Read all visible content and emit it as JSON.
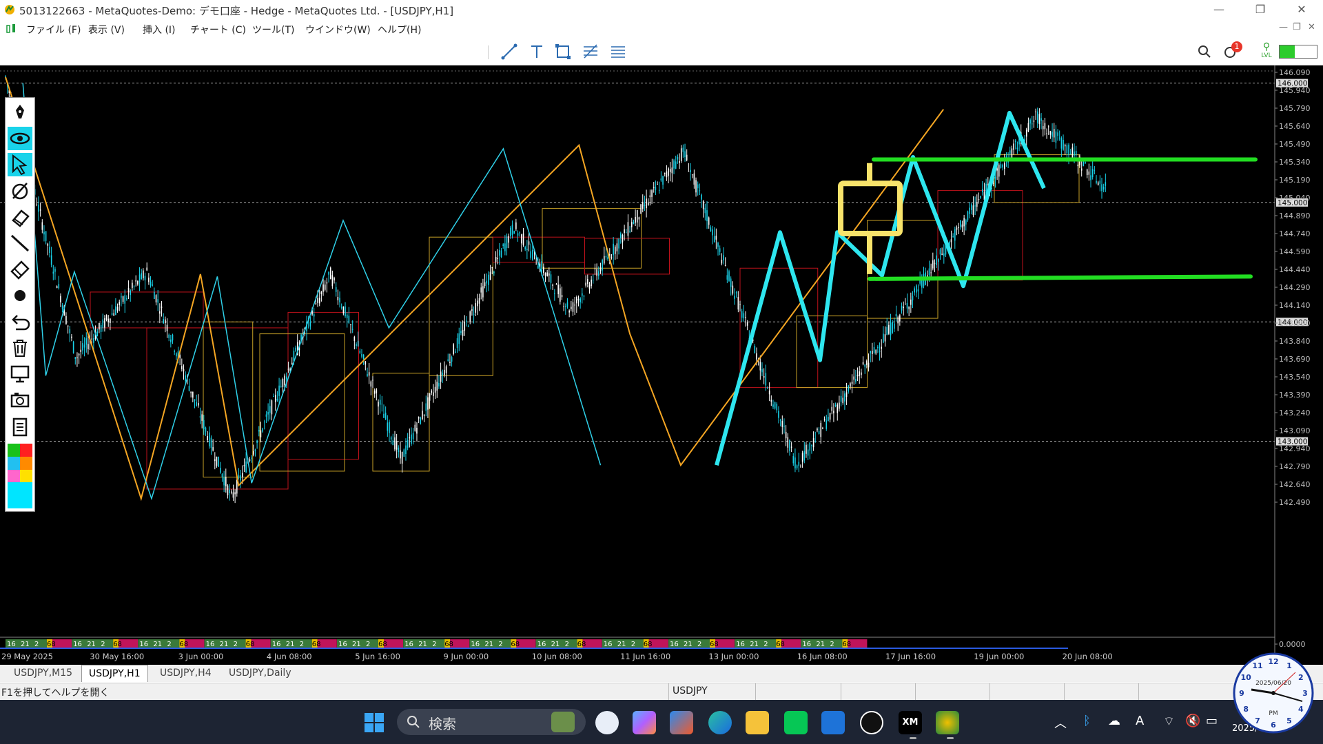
{
  "window": {
    "title": "5013122663 - MetaQuotes-Demo: デモ口座 - Hedge - MetaQuotes Ltd. - [USDJPY,H1]",
    "controls": [
      "—",
      "❐",
      "✕"
    ]
  },
  "menu": [
    "ファイル (F)",
    "表示 (V)",
    "挿入 (I)",
    "チャート (C)",
    "ツール(T)",
    "ウインドウ(W)",
    "ヘルプ(H)"
  ],
  "toolbar": {
    "tools": [
      "trendline-icon",
      "text-icon",
      "rectangle-icon",
      "fibonacci-icon",
      "channel-icon"
    ],
    "notification_count": "1",
    "level_label": "LVL"
  },
  "chart": {
    "symbol": "USDJPY",
    "timeframe": "H1",
    "price_labels": [
      "146.090",
      "145.940",
      "145.790",
      "145.640",
      "145.490",
      "145.340",
      "145.190",
      "145.040",
      "144.890",
      "144.740",
      "144.590",
      "144.440",
      "144.290",
      "144.140",
      "143.990",
      "143.840",
      "143.690",
      "143.540",
      "143.390",
      "143.240",
      "143.090",
      "142.940",
      "142.790",
      "142.640",
      "142.490",
      "0.0000"
    ],
    "highlight_levels": [
      "146.000",
      "145.000",
      "144.000",
      "143.000"
    ],
    "time_labels": [
      "29 May 2025",
      "30 May 16:00",
      "3 Jun 00:00",
      "4 Jun 08:00",
      "5 Jun 16:00",
      "9 Jun 00:00",
      "10 Jun 08:00",
      "11 Jun 16:00",
      "13 Jun 00:00",
      "16 Jun 08:00",
      "17 Jun 16:00",
      "19 Jun 00:00",
      "20 Jun 08:00"
    ],
    "session_ticks": [
      "16",
      "21",
      "2",
      "68"
    ],
    "colors": {
      "background": "#000000",
      "bull": "#19d3ea",
      "bear": "#ffffff",
      "zigzag_orange": "#f5a623",
      "zigzag_cyan": "#2fd0e8",
      "drawn_cyan": "#2ee6ef",
      "support_green": "#22dd22",
      "highlight_yellow": "#f7e36b",
      "box_yellow": "#c9a227",
      "box_red": "#c0121b"
    }
  },
  "tabs": [
    "USDJPY,M15",
    "USDJPY,H1",
    "USDJPY,H4",
    "USDJPY,Daily"
  ],
  "active_tab": "USDJPY,H1",
  "status": {
    "help": "F1を押してヘルプを開く",
    "symbol": "USDJPY"
  },
  "taskbar": {
    "search_placeholder": "検索",
    "apps": [
      "clock",
      "copilot",
      "store",
      "edge",
      "explorer",
      "line",
      "outlook",
      "tradingview",
      "xm",
      "mt5"
    ],
    "xm_label": "XM"
  },
  "clock": {
    "date": "2025/06/20",
    "period": "PM",
    "time_partial": "2025/"
  },
  "palette": {
    "tools": [
      "pen-icon",
      "eye-icon",
      "cursor-icon",
      "snap-icon",
      "eraser-icon",
      "line-icon",
      "marker-icon",
      "dot-icon",
      "undo-icon",
      "delete-icon",
      "screen-icon",
      "camera-icon",
      "clipboard-icon"
    ],
    "swatches": [
      "#19c119",
      "#ff2020",
      "#22c0f0",
      "#ff8a00",
      "#ff66cc",
      "#ffe000",
      "#00e5ff"
    ]
  }
}
